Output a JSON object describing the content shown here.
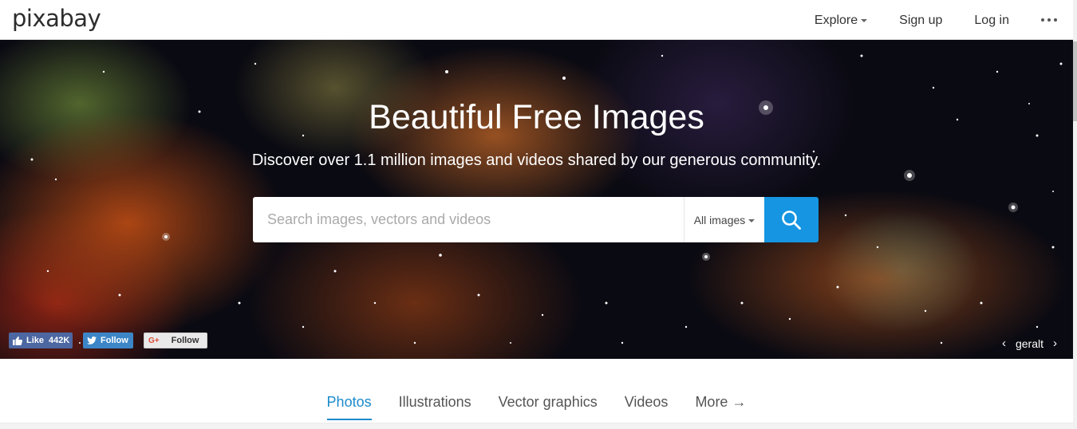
{
  "header": {
    "logo": "pixabay",
    "nav": [
      {
        "label": "Explore",
        "has_caret": true
      },
      {
        "label": "Sign up",
        "has_caret": false
      },
      {
        "label": "Log in",
        "has_caret": false
      }
    ],
    "more_icon": "more-dots-icon"
  },
  "hero": {
    "title": "Beautiful Free Images",
    "subtitle": "Discover over 1.1 million images and videos shared by our generous community.",
    "search": {
      "placeholder": "Search images, vectors and videos",
      "value": "",
      "type_selected": "All images",
      "button_icon": "search-icon"
    },
    "social": {
      "facebook_label": "Like",
      "facebook_count": "442K",
      "twitter_label": "Follow",
      "googleplus_label": "Follow"
    },
    "credit": {
      "prev": "‹",
      "author": "geralt",
      "next": "›"
    }
  },
  "tabs": [
    {
      "label": "Photos",
      "active": true
    },
    {
      "label": "Illustrations",
      "active": false
    },
    {
      "label": "Vector graphics",
      "active": false
    },
    {
      "label": "Videos",
      "active": false
    },
    {
      "label": "More →",
      "active": false
    }
  ],
  "colors": {
    "accent": "#1595e2",
    "tab_active": "#1a8acb",
    "facebook": "#4c67a1",
    "twitter": "#3c86c8"
  }
}
